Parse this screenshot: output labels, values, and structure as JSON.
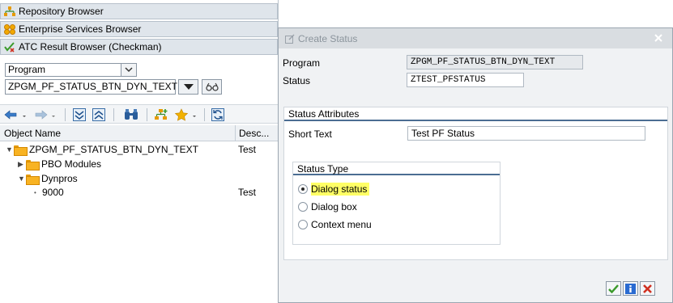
{
  "nav": {
    "repository_browser": "Repository Browser",
    "enterprise_services_browser": "Enterprise Services Browser",
    "atc_result_browser": "ATC Result Browser (Checkman)"
  },
  "selector": {
    "object_type": "Program",
    "object_name": "ZPGM_PF_STATUS_BTN_DYN_TEXT"
  },
  "columns": {
    "object_name": "Object Name",
    "description": "Desc..."
  },
  "tree": {
    "root": {
      "name": "ZPGM_PF_STATUS_BTN_DYN_TEXT",
      "desc": "Test"
    },
    "pbo": {
      "name": "PBO Modules",
      "desc": ""
    },
    "dynpros": {
      "name": "Dynpros",
      "desc": ""
    },
    "screen": {
      "name": "9000",
      "desc": "Test"
    }
  },
  "dialog": {
    "title": "Create Status",
    "program_label": "Program",
    "program_value": "ZPGM_PF_STATUS_BTN_DYN_TEXT",
    "status_label": "Status",
    "status_value": "ZTEST_PFSTATUS",
    "attributes_title": "Status Attributes",
    "short_text_label": "Short Text",
    "short_text_value": "Test PF Status",
    "status_type_title": "Status Type",
    "options": [
      "Dialog status",
      "Dialog box",
      "Context menu"
    ],
    "selected_option": "Dialog status"
  },
  "colors": {
    "highlight": "#ffff66",
    "confirm_green": "#3a9a2a",
    "info_blue": "#2a6bd1",
    "cancel_red": "#d03020",
    "group_rule": "#4b6d92"
  }
}
